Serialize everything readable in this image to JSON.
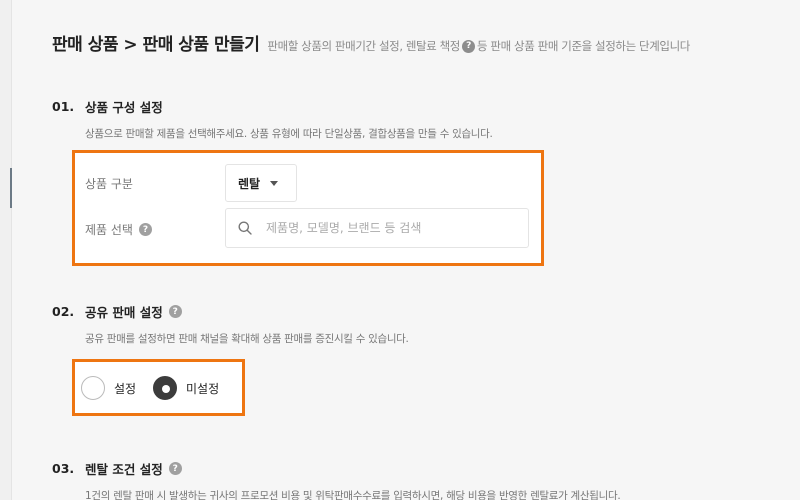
{
  "header": {
    "title": "판매 상품 > 판매 상품 만들기",
    "desc_before": "판매할 상품의 판매기간 설정, 렌탈료 책정",
    "desc_after": "등 판매 상품 판매 기준을 설정하는 단계입니다",
    "help_glyph": "?"
  },
  "sections": [
    {
      "num": "01.",
      "title": "상품 구성 설정",
      "desc": "상품으로 판매할 제품을 선택해주세요. 상품 유형에 따라 단일상품, 결합상품을 만들 수 있습니다."
    },
    {
      "num": "02.",
      "title": "공유 판매 설정",
      "desc": "공유 판매를 설정하면 판매 채널을 확대해 상품 판매를 증진시킬 수 있습니다."
    },
    {
      "num": "03.",
      "title": "렌탈 조건 설정",
      "desc": "1건의 렌탈 판매 시 발생하는 귀사의 프로모션 비용 및 위탁판매수수료를 입력하시면, 해당 비용을 반영한 렌탈료가 계산됩니다."
    }
  ],
  "product_form": {
    "category_label": "상품 구분",
    "category_value": "렌탈",
    "product_select_label": "제품 선택",
    "search_placeholder": "제품명, 모델명, 브랜드 등 검색",
    "search_value": ""
  },
  "shared_sale": {
    "options": [
      {
        "label": "설정",
        "checked": false
      },
      {
        "label": "미설정",
        "checked": true
      }
    ]
  },
  "colors": {
    "highlight": "#ee7511",
    "radio_checked": "#3c3c3c"
  },
  "icons": {
    "search": "search-icon",
    "help": "question-circle-icon",
    "dropdown": "chevron-down-icon"
  }
}
